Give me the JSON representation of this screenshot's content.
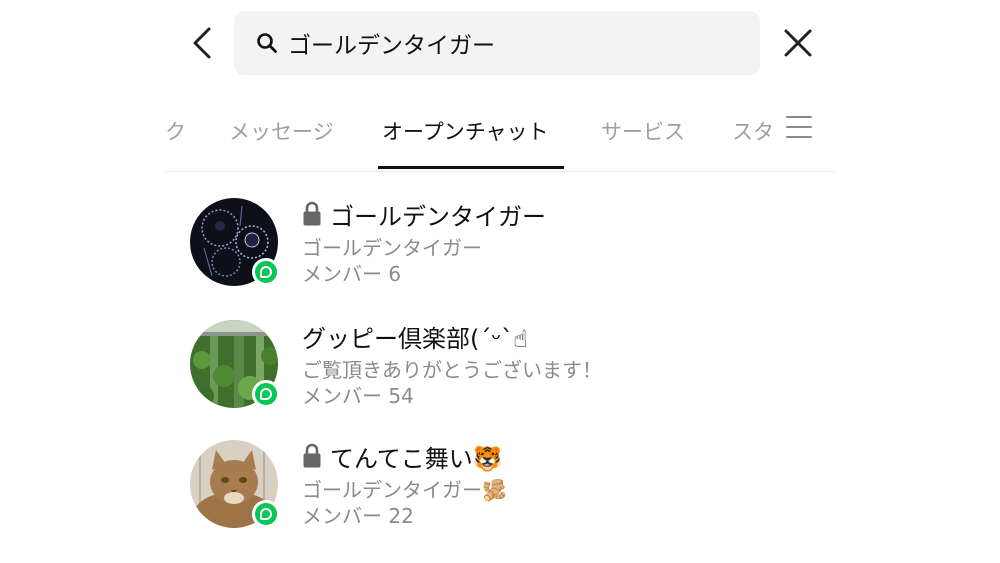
{
  "search": {
    "query": "ゴールデンタイガー"
  },
  "tabs": [
    {
      "label": "ク",
      "active": false
    },
    {
      "label": "メッセージ",
      "active": false
    },
    {
      "label": "オープンチャット",
      "active": true
    },
    {
      "label": "サービス",
      "active": false
    },
    {
      "label": "スタ",
      "active": false
    }
  ],
  "results": [
    {
      "name": "ゴールデンタイガー",
      "locked": true,
      "subtitle": "ゴールデンタイガー",
      "members": "メンバー 6",
      "avatar": "jellyfish-avatar"
    },
    {
      "name": "グッピー倶楽部(ˊᵕˋ☝",
      "locked": false,
      "subtitle": "ご覧頂きありがとうございます！",
      "members": "メンバー 54",
      "avatar": "aquarium-avatar"
    },
    {
      "name": "てんてこ舞い🐯",
      "locked": true,
      "subtitle": "ゴールデンタイガー🫚",
      "members": "メンバー 22",
      "avatar": "cat-avatar"
    }
  ],
  "colors": {
    "badge": "#06c755",
    "muted_text": "#8b8b8f",
    "search_bg": "#f3f3f4"
  }
}
